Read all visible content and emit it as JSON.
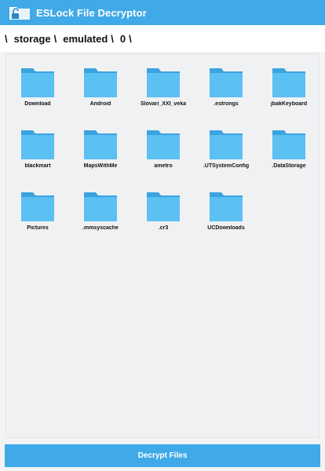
{
  "app": {
    "title": "ESLock File Decryptor",
    "accent_color": "#40a9e8",
    "icon": "unlock-folder-icon"
  },
  "breadcrumb": {
    "separator": "\\",
    "segments": [
      "storage",
      "emulated",
      "0"
    ]
  },
  "folders": [
    {
      "label": "Download"
    },
    {
      "label": "Android"
    },
    {
      "label": "Slovari_XXI_veka"
    },
    {
      "label": ".estrongs"
    },
    {
      "label": "jbakKeyboard"
    },
    {
      "label": "blackmart"
    },
    {
      "label": "MapsWithMe"
    },
    {
      "label": "ametro"
    },
    {
      "label": ".UTSystemConfig"
    },
    {
      "label": ".DataStorage"
    },
    {
      "label": "Pictures"
    },
    {
      "label": ".mmsyscache"
    },
    {
      "label": ".cr3"
    },
    {
      "label": "UCDownloads"
    }
  ],
  "folder_icon": "folder-icon",
  "footer": {
    "decrypt_label": "Decrypt Files"
  }
}
